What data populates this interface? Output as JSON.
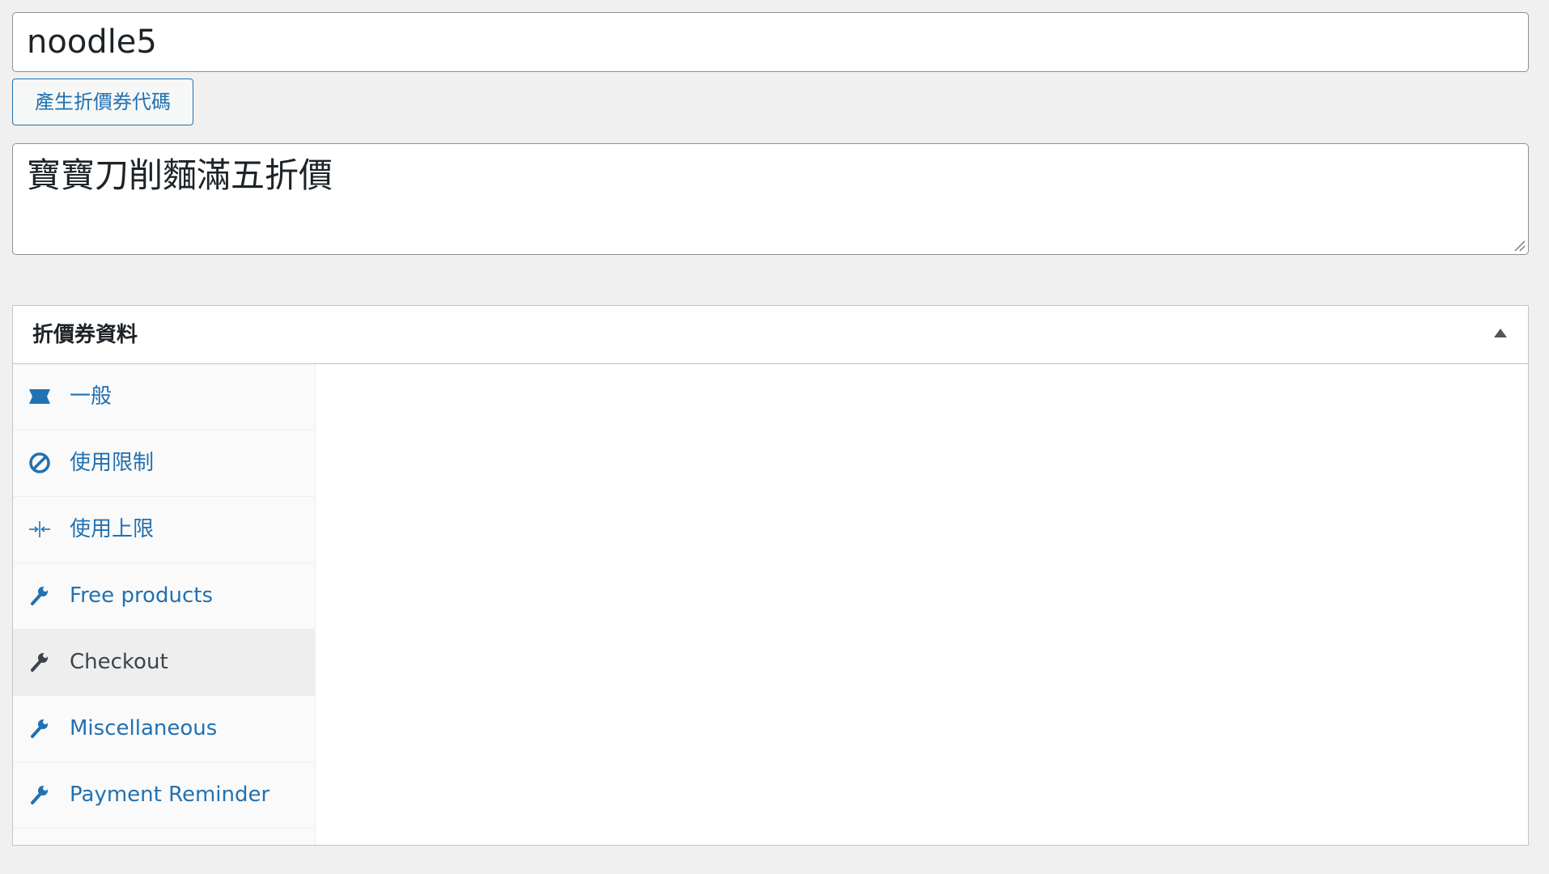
{
  "coupon": {
    "code_value": "noodle5",
    "generate_button_label": "產生折價券代碼",
    "description_value": "寶寶刀削麵滿五折價"
  },
  "metabox": {
    "title": "折價券資料",
    "tabs": [
      {
        "label": "一般",
        "icon": "ticket-icon",
        "active": false
      },
      {
        "label": "使用限制",
        "icon": "no-entry-icon",
        "active": false
      },
      {
        "label": "使用上限",
        "icon": "arrows-in-icon",
        "active": false
      },
      {
        "label": "Free products",
        "icon": "wrench-icon",
        "active": false
      },
      {
        "label": "Checkout",
        "icon": "wrench-icon",
        "active": true
      },
      {
        "label": "Miscellaneous",
        "icon": "wrench-icon",
        "active": false
      },
      {
        "label": "Payment Reminder",
        "icon": "wrench-icon",
        "active": false
      }
    ]
  },
  "colors": {
    "accent": "#2271b1",
    "page_background": "#f0f0f1",
    "active_tab_background": "#eeeeee",
    "active_tab_text": "#3c434a"
  }
}
